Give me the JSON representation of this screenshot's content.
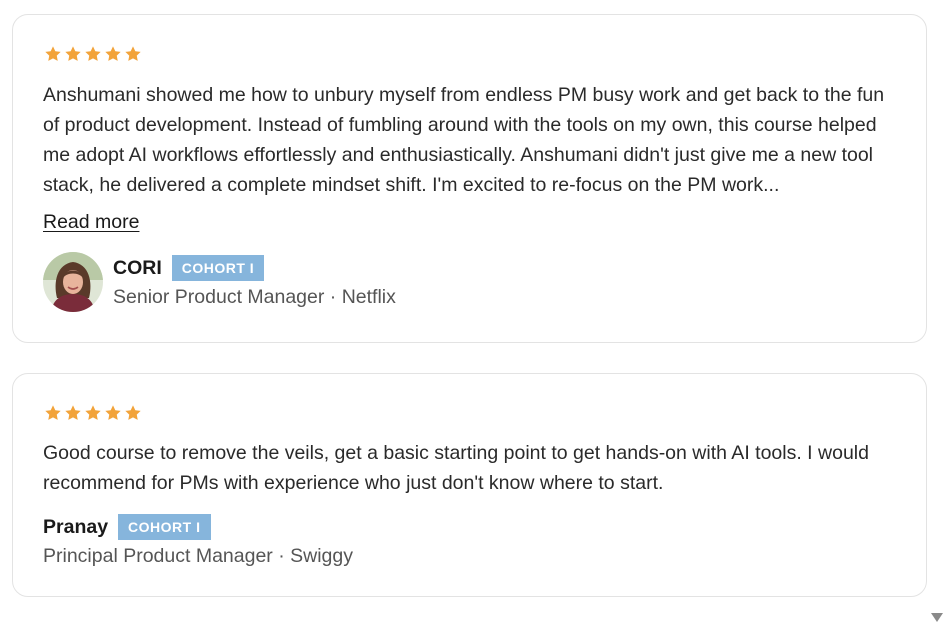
{
  "reviews": [
    {
      "rating": 5,
      "text": "Anshumani showed me how to unbury myself from endless PM busy work and get back to the fun of product development. Instead of fumbling around with the tools on my own, this course helped me adopt AI workflows effortlessly and enthusiastically. Anshumani didn't just give me a new tool stack, he delivered a complete mindset shift. I'm excited to re-focus on the PM work...",
      "read_more": "Read more",
      "name": "CORI",
      "badge": "COHORT I",
      "role": "Senior Product Manager · Netflix"
    },
    {
      "rating": 5,
      "text": "Good course to remove the veils, get a basic starting point to get hands-on with AI tools. I would recommend for PMs with experience who just don't know where to start.",
      "name": "Pranay",
      "badge": "COHORT I",
      "role": "Principal Product Manager · Swiggy"
    }
  ],
  "colors": {
    "star": "#f2a33a",
    "badge_bg": "#86b5dc",
    "card_border": "#e3e3e3"
  },
  "icons": {
    "star": "star-icon",
    "avatar": "avatar-photo",
    "scroll": "scroll-down-arrow-icon"
  }
}
